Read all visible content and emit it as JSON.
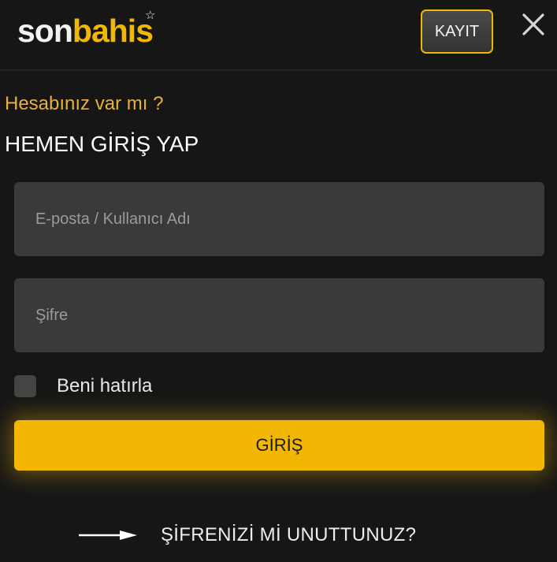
{
  "header": {
    "logo_part1": "son",
    "logo_part2": "bahis",
    "register_label": "KAYIT",
    "close_icon": "close-icon"
  },
  "login": {
    "question": "Hesabınız var mı ?",
    "title": "HEMEN GİRİŞ YAP",
    "email_placeholder": "E-posta / Kullanıcı Adı",
    "email_value": "",
    "password_placeholder": "Şifre",
    "password_value": "",
    "remember_label": "Beni hatırla",
    "remember_checked": false,
    "submit_label": "GİRİŞ",
    "forgot_label": "ŞİFRENİZİ Mİ UNUTTUNUZ?",
    "forgot_icon": "arrow-right-icon"
  },
  "colors": {
    "background": "#161616",
    "accent": "#f2b705",
    "input_bg": "#3a3a3a",
    "question_text": "#e6b13d"
  }
}
